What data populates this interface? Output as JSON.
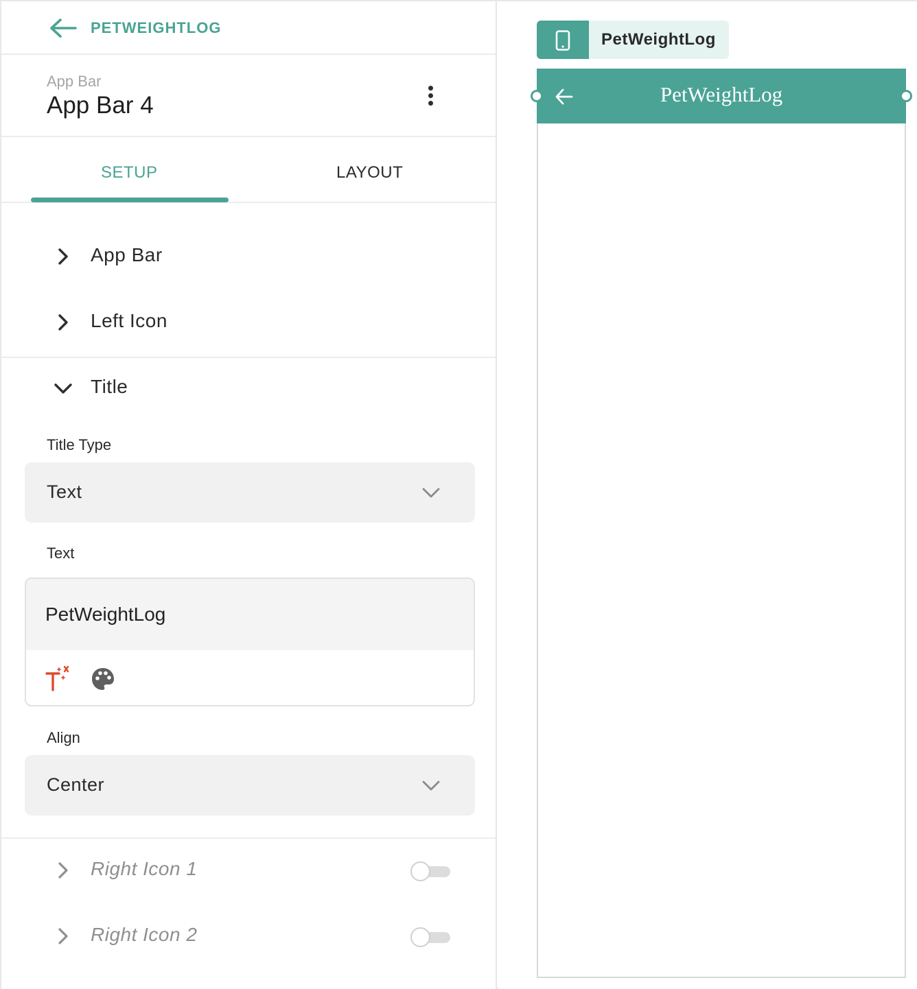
{
  "topbar": {
    "back_label": "PETWEIGHTLOG"
  },
  "header": {
    "subtitle": "App Bar",
    "title": "App Bar 4"
  },
  "tabs": [
    {
      "label": "SETUP",
      "active": true
    },
    {
      "label": "LAYOUT",
      "active": false
    }
  ],
  "sections": {
    "app_bar": "App Bar",
    "left_icon": "Left Icon",
    "title": "Title",
    "right_icon_1": "Right Icon 1",
    "right_icon_2": "Right Icon 2"
  },
  "title_section": {
    "title_type_label": "Title Type",
    "title_type_value": "Text",
    "text_label": "Text",
    "text_value": "PetWeightLog",
    "align_label": "Align",
    "align_value": "Center"
  },
  "toggles": {
    "right_icon_1_on": false,
    "right_icon_2_on": false
  },
  "preview": {
    "page_chip_label": "PetWeightLog",
    "appbar_title": "PetWeightLog"
  },
  "colors": {
    "accent": "#4aa394",
    "accent_light": "#e6f4f1",
    "text_icon_red": "#e04a2c",
    "muted": "#8f8f8f"
  },
  "icons": [
    "arrow-left-icon",
    "more-vert-icon",
    "chevron-right-icon",
    "chevron-down-icon",
    "text-magic-icon",
    "palette-icon",
    "phone-icon"
  ]
}
